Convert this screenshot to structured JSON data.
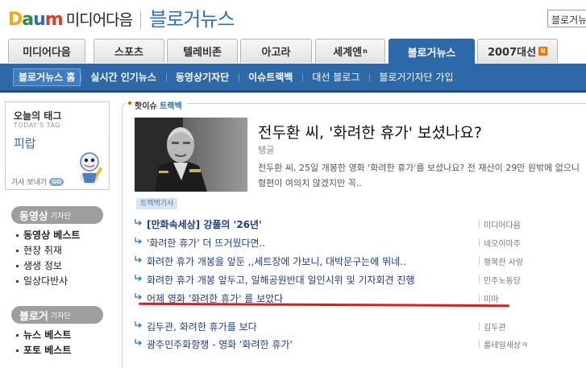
{
  "header": {
    "logo_daum": [
      "D",
      "a",
      "u",
      "m"
    ],
    "logo_media": "미디어다음",
    "logo_blog": "블로거뉴스",
    "search_value": "블로거뉴"
  },
  "tabs": [
    {
      "label": "미디어다음",
      "active": false
    },
    {
      "label": "스포츠",
      "active": false
    },
    {
      "label": "텔레비존",
      "active": false
    },
    {
      "label": "아고라",
      "active": false
    },
    {
      "label": "세계엔",
      "sup": "n",
      "active": false
    },
    {
      "label": "블로거뉴스",
      "active": true
    },
    {
      "label": "2007대선",
      "badge": "N",
      "active": false
    }
  ],
  "subnav": [
    {
      "label": "블로거뉴스 홈"
    },
    {
      "label": "실시간 인기뉴스"
    },
    {
      "label": "동영상기자단"
    },
    {
      "label": "이슈트랙백"
    },
    {
      "label": "대선 블로그"
    },
    {
      "label": "블로거기자단 가입"
    }
  ],
  "sidebar": {
    "today_tag": {
      "title": "오늘의 태그",
      "subtitle": "TODAY'S TAG",
      "tag": "피랍",
      "send_label": "기사 보내기",
      "go_label": "GO"
    },
    "video_section": {
      "title": "동영상",
      "title_small": "기자단",
      "items": [
        {
          "label": "동영상 베스트",
          "bold": true
        },
        {
          "label": "현장 취재",
          "bold": false
        },
        {
          "label": "생생 정보",
          "bold": false
        },
        {
          "label": "일상다반사",
          "bold": false
        }
      ]
    },
    "blogger_section": {
      "title": "블로거",
      "title_small": "기자단",
      "items": [
        {
          "label": "뉴스 베스트",
          "bold": true
        },
        {
          "label": "포토 베스트",
          "bold": true
        }
      ]
    }
  },
  "main": {
    "hot_label": "핫이슈",
    "hot_sub": "트랙백",
    "headline": "전두환 씨, '화려한 휴가' 보셨나요?",
    "author": "탱굴",
    "summary": "전두환 씨, 25일 개봉한 영화 '화려한 휴가'를 보셨나요? 전 재산이 29만 원밖에 없으니 형편이 여의치 않겠지만 꼭..",
    "trackback_badge": "트랙백기사",
    "trackbacks": [
      {
        "title": "[만화속세상] 강풀의 '26년'",
        "source": "미디어다음"
      },
      {
        "title": "'화려한 휴가' 더 뜨거웠다면..",
        "source": "네오이마주"
      },
      {
        "title": "화려한 휴가 개봉을 앞둔 ,,세트장에 가보니, 대박문구는에 뛰네..",
        "source": "행복한 사랑"
      },
      {
        "title": "화려한 휴가 개봉 앞두고, 일해공원반대 일인시위 및 기자회견 진행",
        "source": "민주노동당"
      },
      {
        "title": "어제 영화 '화려한 휴가' 를 보았다",
        "source": "미마"
      },
      {
        "title": "김두관, 화려한 휴가를 보다",
        "source": "김두관"
      },
      {
        "title": "광주민주화항쟁 - 영화 '화려한 휴가'",
        "source": "룰테일세상ㅋ"
      }
    ]
  }
}
